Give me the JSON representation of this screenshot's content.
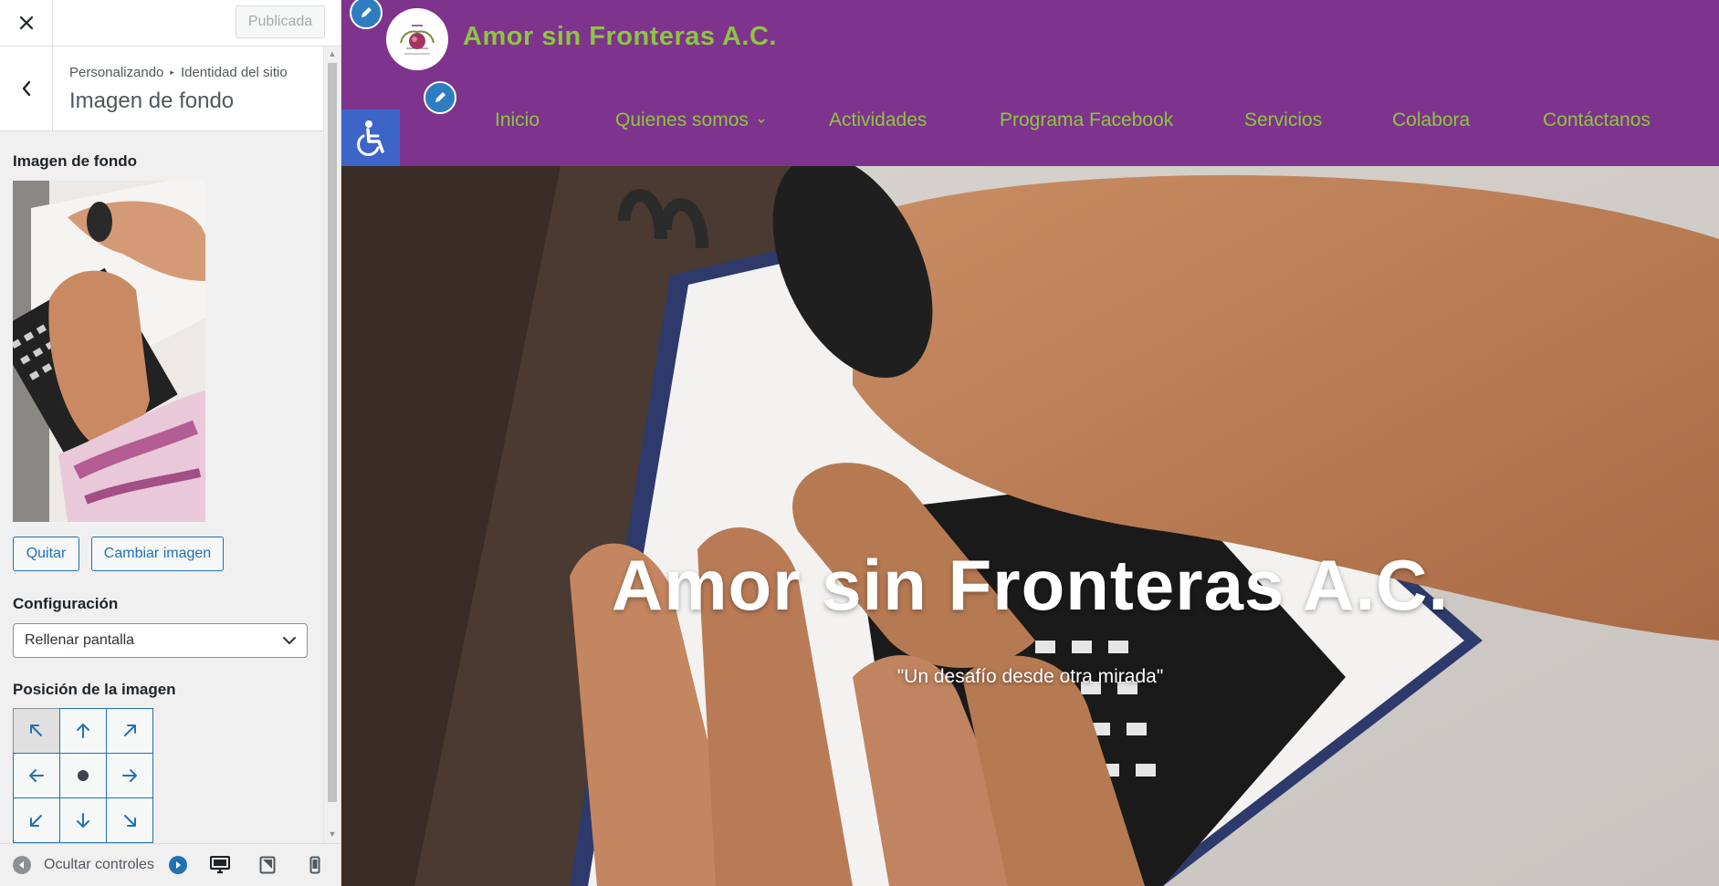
{
  "customizer": {
    "close_icon": "close-icon",
    "publish_label": "Publicada",
    "breadcrumb": {
      "root": "Personalizando",
      "separator": "▸",
      "parent": "Identidad del sitio"
    },
    "section_title": "Imagen de fondo",
    "background_image": {
      "label": "Imagen de fondo",
      "remove_label": "Quitar",
      "change_label": "Cambiar imagen"
    },
    "configuration": {
      "label": "Configuración",
      "selected": "Rellenar pantalla"
    },
    "position": {
      "label": "Posición de la imagen",
      "selected": "top-left",
      "cells": [
        "top-left",
        "top",
        "top-right",
        "left",
        "center",
        "right",
        "bottom-left",
        "bottom",
        "bottom-right"
      ]
    },
    "footer": {
      "collapse_label": "Ocultar controles",
      "devices": [
        "desktop",
        "tablet",
        "mobile"
      ]
    },
    "colors": {
      "accent": "#2271b1",
      "text": "#1d2327",
      "muted": "#50575e"
    }
  },
  "site": {
    "name": "Amor sin Fronteras A.C.",
    "nav": [
      "Inicio",
      "Quienes somos",
      "Actividades",
      "Programa Facebook",
      "Servicios",
      "Colabora",
      "Contáctanos"
    ],
    "hero_title": "Amor sin Fronteras A.C.",
    "hero_subtitle": "\"Un desafío desde otra mirada\"",
    "colors": {
      "header_bg": "#7e348c",
      "brand_green": "#8dc541",
      "accessibility_bg": "#3d64c7"
    }
  }
}
